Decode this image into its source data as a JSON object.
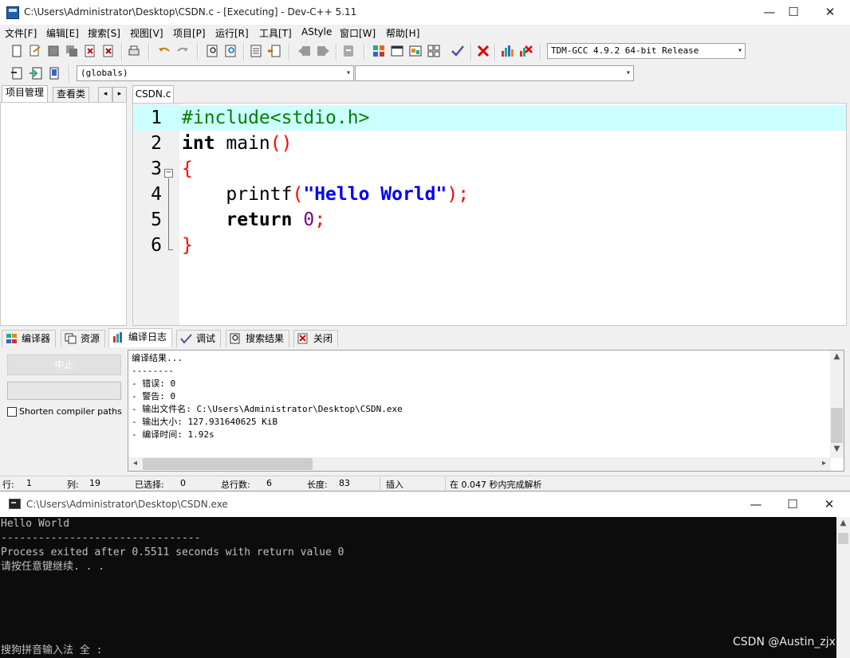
{
  "ide": {
    "title": "C:\\Users\\Administrator\\Desktop\\CSDN.c - [Executing] - Dev-C++ 5.11",
    "window_buttons": {
      "minimize": "—",
      "maximize": "☐",
      "close": "✕"
    },
    "menu": [
      "文件[F]",
      "编辑[E]",
      "搜索[S]",
      "视图[V]",
      "项目[P]",
      "运行[R]",
      "工具[T]",
      "AStyle",
      "窗口[W]",
      "帮助[H]"
    ],
    "compiler_select": "TDM-GCC 4.9.2 64-bit Release",
    "scope_select": "(globals)",
    "symbol_select": "",
    "left_tabs": [
      "项目管理",
      "查看类"
    ],
    "editor_tab": "CSDN.c",
    "code_lines": [
      {
        "n": "1",
        "tokens": [
          {
            "t": "#include<stdio.h>",
            "c": "pp"
          }
        ]
      },
      {
        "n": "2",
        "tokens": [
          {
            "t": "int",
            "c": "kw"
          },
          {
            "t": " main",
            "c": ""
          },
          {
            "t": "()",
            "c": "sym"
          }
        ]
      },
      {
        "n": "3",
        "tokens": [
          {
            "t": "{",
            "c": "sym"
          }
        ]
      },
      {
        "n": "4",
        "tokens": [
          {
            "t": "    printf",
            "c": ""
          },
          {
            "t": "(",
            "c": "sym"
          },
          {
            "t": "\"Hello World\"",
            "c": "str"
          },
          {
            "t": ");",
            "c": "sym"
          }
        ]
      },
      {
        "n": "5",
        "tokens": [
          {
            "t": "    ",
            "c": ""
          },
          {
            "t": "return",
            "c": "kw"
          },
          {
            "t": " ",
            "c": ""
          },
          {
            "t": "0",
            "c": "num"
          },
          {
            "t": ";",
            "c": "sym"
          }
        ]
      },
      {
        "n": "6",
        "tokens": [
          {
            "t": "}",
            "c": "sym"
          }
        ]
      }
    ],
    "bottom_tabs": [
      "编译器",
      "资源",
      "编译日志",
      "调试",
      "搜索结果",
      "关闭"
    ],
    "stop_button": "中止",
    "shorten_paths_label": "Shorten compiler paths",
    "log_lines": [
      "编译结果...",
      "--------",
      "- 错误: 0",
      "- 警告: 0",
      "- 输出文件名: C:\\Users\\Administrator\\Desktop\\CSDN.exe",
      "- 输出大小: 127.931640625 KiB",
      "- 编译时间: 1.92s"
    ],
    "status": {
      "row_label": "行:",
      "row": "1",
      "col_label": "列:",
      "col": "19",
      "sel_label": "已选择:",
      "sel": "0",
      "lines_label": "总行数:",
      "lines": "6",
      "len_label": "长度:",
      "len": "83",
      "mode": "插入",
      "parse": "在 0.047 秒内完成解析"
    }
  },
  "console": {
    "title": "C:\\Users\\Administrator\\Desktop\\CSDN.exe",
    "window_buttons": {
      "minimize": "—",
      "maximize": "☐",
      "close": "✕"
    },
    "lines": [
      "Hello World",
      "--------------------------------",
      "Process exited after 0.5511 seconds with return value 0",
      "请按任意键继续. . ."
    ],
    "ime": "搜狗拼音输入法 全 :"
  },
  "watermark": "CSDN @Austin_zjx"
}
